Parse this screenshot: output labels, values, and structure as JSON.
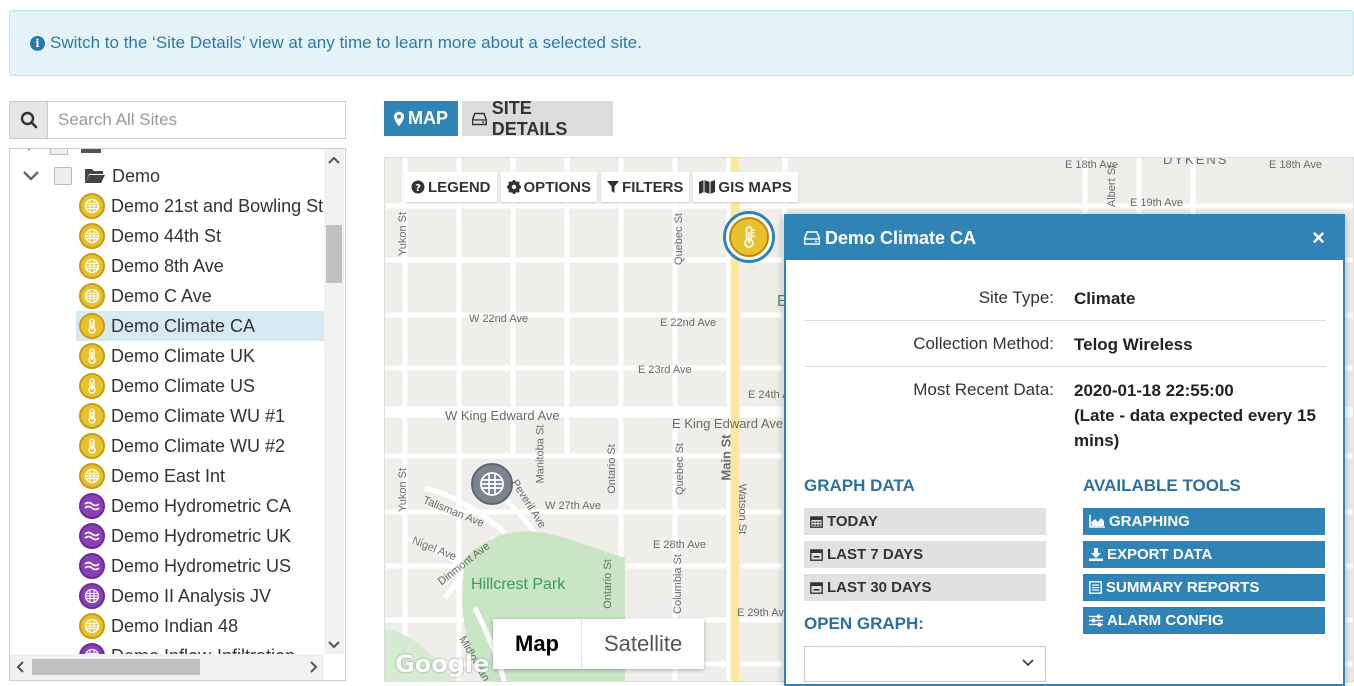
{
  "banner": {
    "text": "Switch to the ‘Site Details’ view at any time to learn more about a selected site."
  },
  "search": {
    "placeholder": "Search All Sites"
  },
  "tree": {
    "folder": "Demo",
    "items": [
      {
        "label": "Demo 21st and Bowling St",
        "icon": "grid",
        "color": "yellow"
      },
      {
        "label": "Demo 44th St",
        "icon": "grid",
        "color": "yellow"
      },
      {
        "label": "Demo 8th Ave",
        "icon": "grid",
        "color": "yellow"
      },
      {
        "label": "Demo C Ave",
        "icon": "grid",
        "color": "yellow"
      },
      {
        "label": "Demo Climate CA",
        "icon": "thermometer",
        "color": "yellow",
        "selected": true
      },
      {
        "label": "Demo Climate UK",
        "icon": "thermometer",
        "color": "yellow"
      },
      {
        "label": "Demo Climate US",
        "icon": "thermometer",
        "color": "yellow"
      },
      {
        "label": "Demo Climate WU #1",
        "icon": "thermometer",
        "color": "yellow"
      },
      {
        "label": "Demo Climate WU #2",
        "icon": "thermometer",
        "color": "yellow"
      },
      {
        "label": "Demo East Int",
        "icon": "grid",
        "color": "yellow"
      },
      {
        "label": "Demo Hydrometric CA",
        "icon": "wave",
        "color": "purple"
      },
      {
        "label": "Demo Hydrometric UK",
        "icon": "wave",
        "color": "purple"
      },
      {
        "label": "Demo Hydrometric US",
        "icon": "wave",
        "color": "purple"
      },
      {
        "label": "Demo II Analysis JV",
        "icon": "grid",
        "color": "purple"
      },
      {
        "label": "Demo Indian 48",
        "icon": "grid",
        "color": "yellow"
      },
      {
        "label": "Demo Inflow-Infiltration",
        "icon": "grid",
        "color": "purple"
      }
    ]
  },
  "tabs": {
    "map": "MAP",
    "details": "SITE DETAILS"
  },
  "toolbar": {
    "legend": "LEGEND",
    "options": "OPTIONS",
    "filters": "FILTERS",
    "gis": "GIS MAPS"
  },
  "map": {
    "labels": {
      "w22": "W 22nd Ave",
      "e22": "E 22nd Ave",
      "e23": "E 23rd Ave",
      "e24": "E 24th A",
      "wking": "W King Edward Ave",
      "eking": "E King Edward Ave",
      "w27": "W 27th Ave",
      "e28": "E 28th Ave",
      "e29": "E 29th Ave",
      "e18": "E 18th Ave",
      "e19": "E 19th Ave",
      "e18b": "E 18th Ave",
      "dyke": "DYKENS",
      "yukon1": "Yukon St",
      "yukon2": "Yukon St",
      "quebec1": "Quebec St",
      "quebec2": "Quebec St",
      "ontario1": "Ontario St",
      "ontario2": "Ontario St",
      "manitoba": "Manitoba St",
      "columbia": "Columbia St",
      "main": "Main St",
      "watson": "Watson St",
      "albert": "Albert St",
      "talisman": "Talisman Ave",
      "peveril": "Peveril Ave",
      "nigel": "Nigel Ave",
      "dinmont": "Dinmont Ave",
      "midlothian": "Midlothian",
      "park": "Hillcrest Park",
      "e_letter": "E"
    },
    "maptype": {
      "map": "Map",
      "satellite": "Satellite"
    },
    "google": "Google"
  },
  "popup": {
    "title": "Demo Climate CA",
    "close": "×",
    "site_type_label": "Site Type:",
    "site_type": "Climate",
    "method_label": "Collection Method:",
    "method": "Telog Wireless",
    "recent_label": "Most Recent Data:",
    "recent_value": "2020-01-18 22:55:00",
    "recent_note": "(Late - data expected every 15 mins)",
    "graph_title": "GRAPH DATA",
    "graph_today": "TODAY",
    "graph_7": "LAST 7 DAYS",
    "graph_30": "LAST 30 DAYS",
    "open_graph": "OPEN GRAPH:",
    "tools_title": "AVAILABLE TOOLS",
    "tool_graphing": "GRAPHING",
    "tool_export": "EXPORT DATA",
    "tool_summary": "SUMMARY REPORTS",
    "tool_alarm": "ALARM CONFIG"
  },
  "colors": {
    "accent": "#2f83b5",
    "banner_bg": "#e4f3f9",
    "selected_row": "#d6eaf5"
  }
}
